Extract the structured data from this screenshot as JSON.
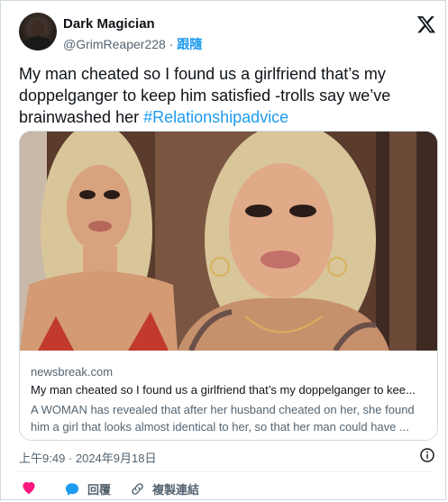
{
  "user": {
    "name": "Dark Magician",
    "handle": "@GrimReaper228",
    "separator": "·",
    "follow_label": "跟隨"
  },
  "tweet": {
    "text": "My man cheated so I found us a girlfriend that’s my doppelganger to keep him satisfied -trolls say we’ve brainwashed her ",
    "hashtag": "#Relationshipadvice"
  },
  "link_card": {
    "domain": "newsbreak.com",
    "headline": "My man cheated so I found us a girlfriend that’s my doppelganger to kee...",
    "description": "A WOMAN has revealed that after her husband cheated on her, she found him a girl that looks almost identical to her, so that her man could have ..."
  },
  "timestamp": "上午9:49 · 2024年9月18日",
  "actions": {
    "reply_label": "回覆",
    "copy_link_label": "複製連結"
  },
  "icons": {
    "logo": "x-logo-icon",
    "info": "info-icon",
    "like": "heart-icon",
    "reply": "reply-bubble-icon",
    "copy": "link-icon"
  },
  "colors": {
    "accent": "#1d9bf0",
    "like": "#f91880",
    "text": "#0f1419",
    "muted": "#536471",
    "border": "#cfd9de"
  }
}
